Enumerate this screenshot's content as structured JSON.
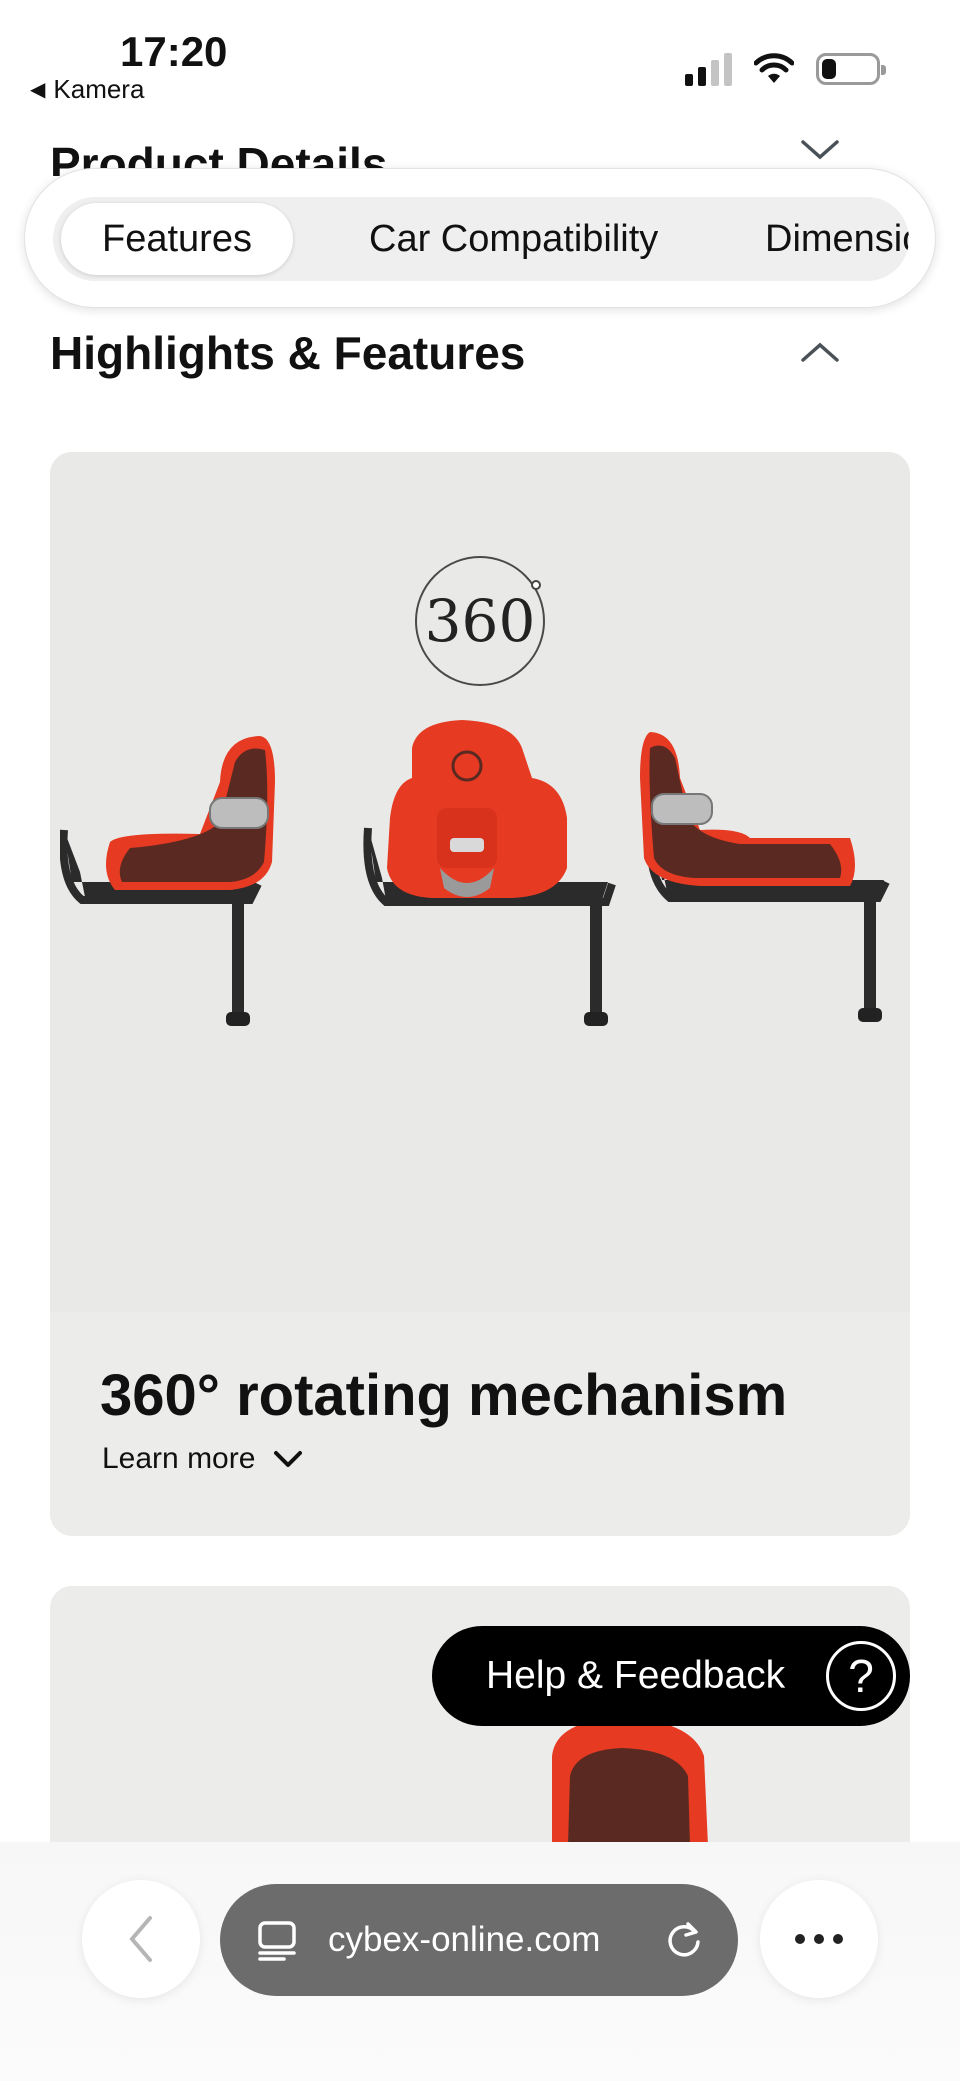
{
  "status_bar": {
    "time": "17:20",
    "back_label": "Kamera",
    "back_glyph": "◀"
  },
  "product_details": {
    "title": "Product Details"
  },
  "tabs": [
    {
      "label": "Features",
      "active": true
    },
    {
      "label": "Car Compatibility",
      "active": false
    },
    {
      "label": "Dimensions",
      "active": false
    }
  ],
  "section": {
    "title": "Highlights & Features"
  },
  "feature_card": {
    "badge": "360",
    "title": "360° rotating mechanism",
    "learn_more": "Learn more",
    "seat_color": "#e63a22",
    "fabric_color": "#5a2a22"
  },
  "help": {
    "label": "Help & Feedback",
    "icon_glyph": "?"
  },
  "browser": {
    "url": "cybex-online.com"
  },
  "colors": {
    "card_bg": "#ececea",
    "help_bg": "#000000",
    "url_bar_bg": "#6c6c6c"
  }
}
